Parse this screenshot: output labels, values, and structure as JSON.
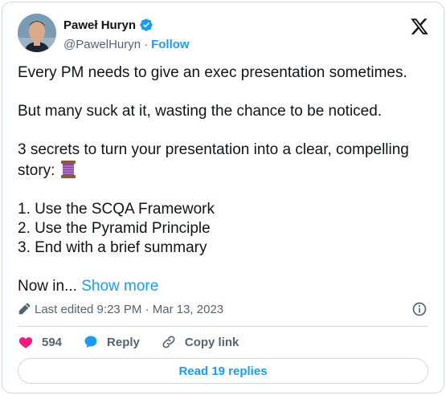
{
  "author": {
    "name": "Paweł Huryn",
    "handle": "@PawelHuryn",
    "separator": "·",
    "follow_label": "Follow"
  },
  "tweet": {
    "paragraphs": [
      "Every PM needs to give an exec presentation sometimes.",
      "But many suck at it, wasting the chance to be noticed.",
      "3 secrets to turn your presentation into a clear, compelling story:"
    ],
    "list_items": [
      "1. Use the SCQA Framework",
      "2. Use the Pyramid Principle",
      "3. End with a brief summary"
    ],
    "truncated_text": "Now in...",
    "show_more_label": "Show more",
    "emoji_icon": "spool-of-thread-icon"
  },
  "meta": {
    "edited_label": "Last edited 9:23 PM · Mar 13, 2023"
  },
  "actions": {
    "like_count": "594",
    "reply_label": "Reply",
    "copy_link_label": "Copy link"
  },
  "read_replies_label": "Read 19 replies",
  "colors": {
    "accent": "#1d9bf0",
    "like": "#f91880",
    "muted": "#536471",
    "text": "#0f1419",
    "border": "#cfd9de"
  }
}
